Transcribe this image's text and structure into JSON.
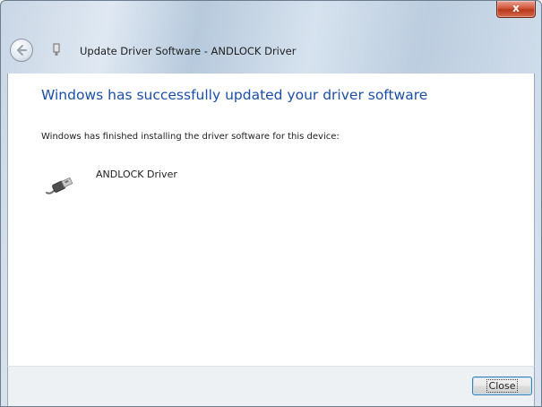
{
  "window": {
    "title": "Update Driver Software - ANDLOCK Driver",
    "close_glyph": "x"
  },
  "icons": {
    "back": "back-arrow-icon",
    "title_device": "usb-device-icon",
    "device": "usb-plug-icon"
  },
  "content": {
    "heading": "Windows has successfully updated your driver software",
    "subtext": "Windows has finished installing the driver software for this device:",
    "device_name": "ANDLOCK Driver"
  },
  "footer": {
    "close_label": "Close"
  },
  "colors": {
    "heading": "#1c4fa6",
    "focus_border": "#3c7fb1"
  }
}
